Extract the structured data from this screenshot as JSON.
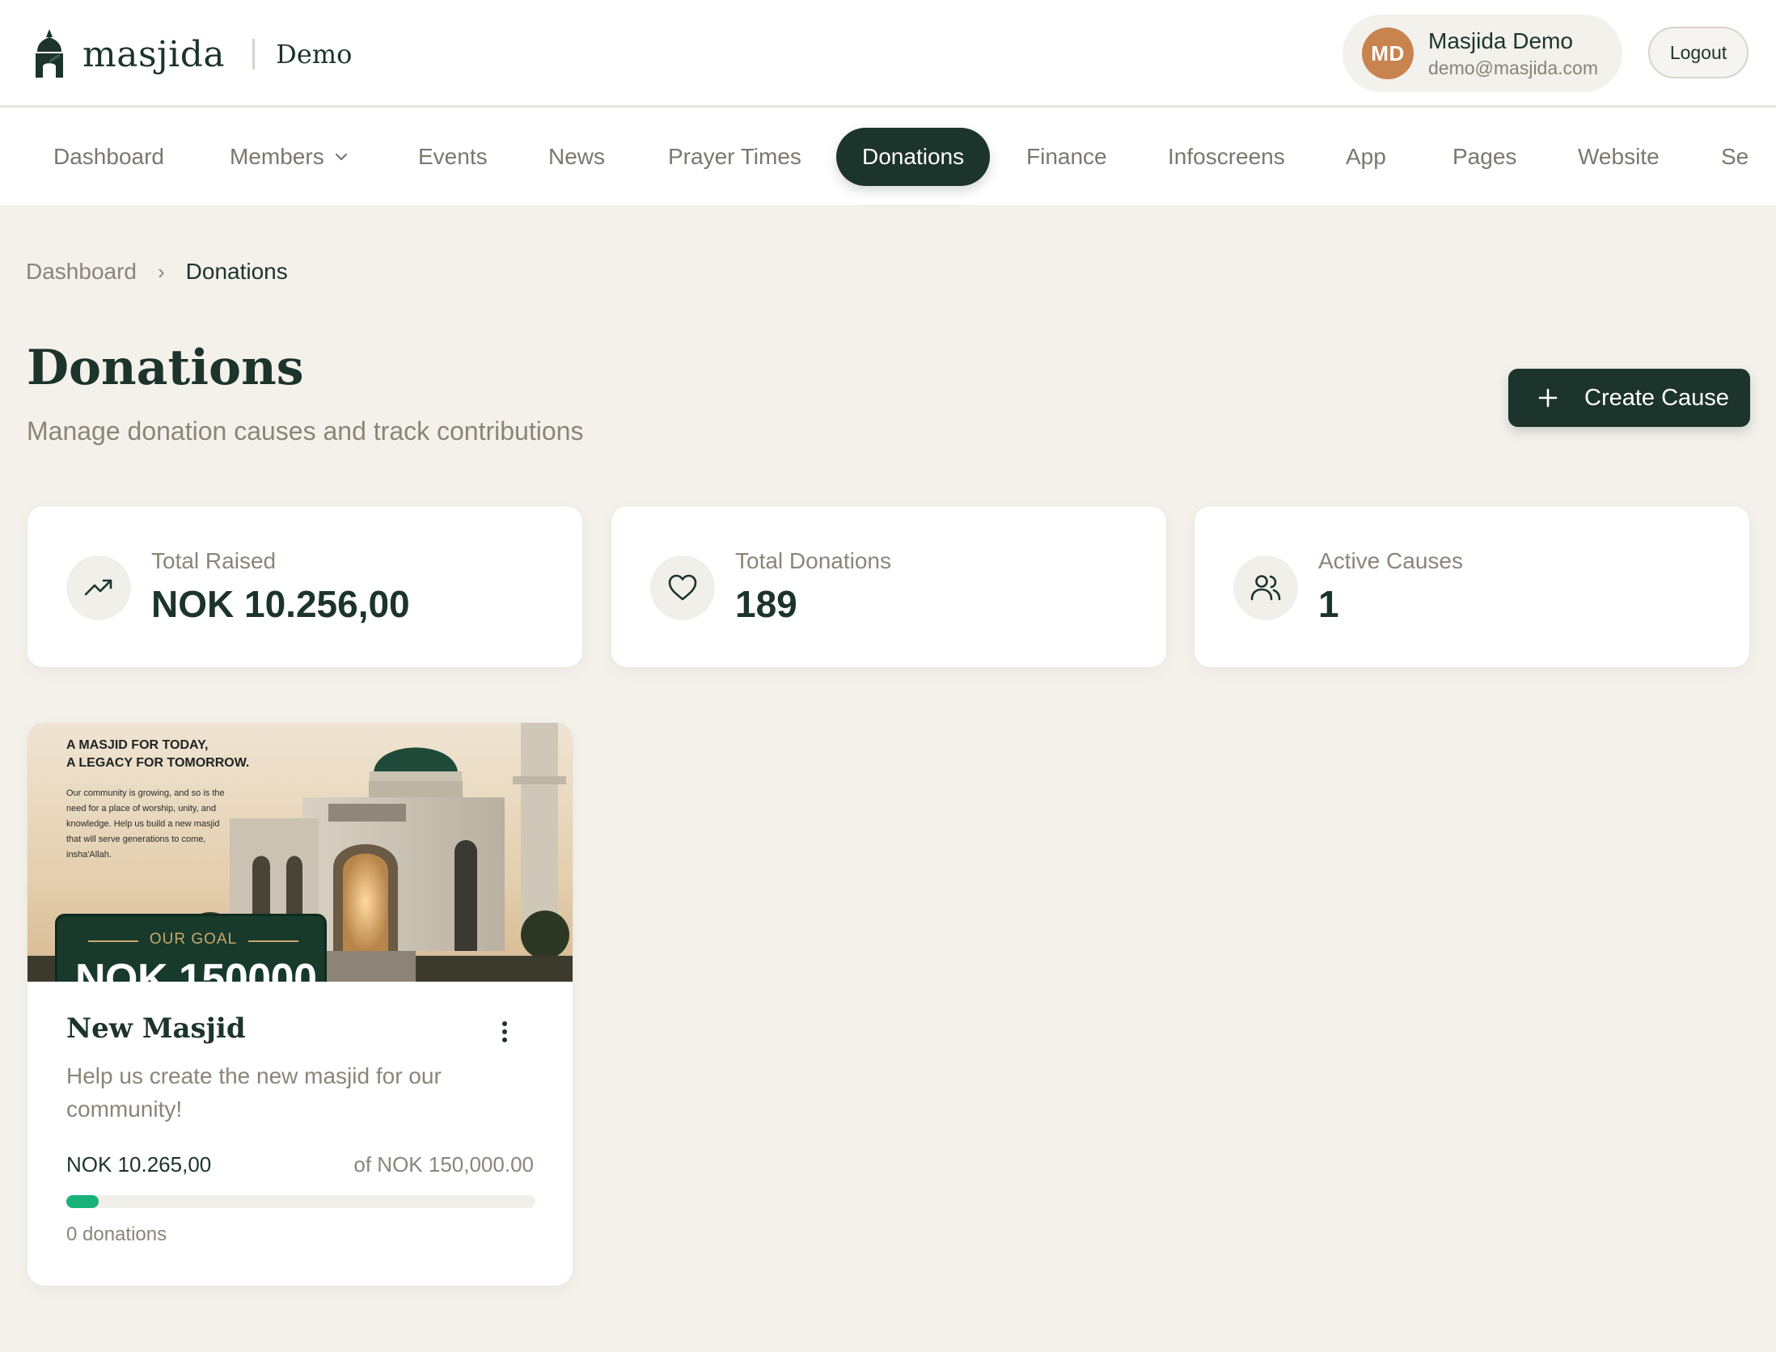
{
  "brand": {
    "name": "masjida",
    "org": "Demo"
  },
  "user": {
    "initials": "MD",
    "name": "Masjida Demo",
    "email": "demo@masjida.com"
  },
  "header": {
    "logout_label": "Logout"
  },
  "nav": {
    "items": [
      {
        "label": "Dashboard"
      },
      {
        "label": "Members"
      },
      {
        "label": "Events"
      },
      {
        "label": "News"
      },
      {
        "label": "Prayer Times"
      },
      {
        "label": "Donations"
      },
      {
        "label": "Finance"
      },
      {
        "label": "Infoscreens"
      },
      {
        "label": "App"
      },
      {
        "label": "Pages"
      },
      {
        "label": "Website"
      },
      {
        "label": "Se"
      }
    ],
    "active": "Donations"
  },
  "breadcrumb": {
    "root": "Dashboard",
    "separator": "›",
    "current": "Donations"
  },
  "page": {
    "title": "Donations",
    "subtitle": "Manage donation causes and track contributions",
    "create_label": "Create Cause"
  },
  "stats": [
    {
      "label": "Total Raised",
      "value": "NOK 10.256,00",
      "icon": "trending-up-icon"
    },
    {
      "label": "Total Donations",
      "value": "189",
      "icon": "heart-icon"
    },
    {
      "label": "Active Causes",
      "value": "1",
      "icon": "users-icon"
    }
  ],
  "causes": [
    {
      "banner": {
        "headline_1": "A MASJID FOR TODAY,",
        "headline_2": "A LEGACY FOR TOMORROW.",
        "body": "Our community is growing, and so is the need for a place of worship, unity, and knowledge. Help us build a new masjid that will serve generations to come, insha'Allah.",
        "goal_label": "OUR GOAL",
        "goal_value": "NOK 150000"
      },
      "title": "New Masjid",
      "description": "Help us create the new masjid for our community!",
      "raised": "NOK 10.265,00",
      "goal_text": "of NOK 150,000.00",
      "progress_fraction": 0.0684,
      "donations_text": "0 donations"
    }
  ],
  "colors": {
    "primary": "#1c342b",
    "background": "#f4f1eb",
    "progress": "#19b27b",
    "avatar": "#c9834f"
  }
}
